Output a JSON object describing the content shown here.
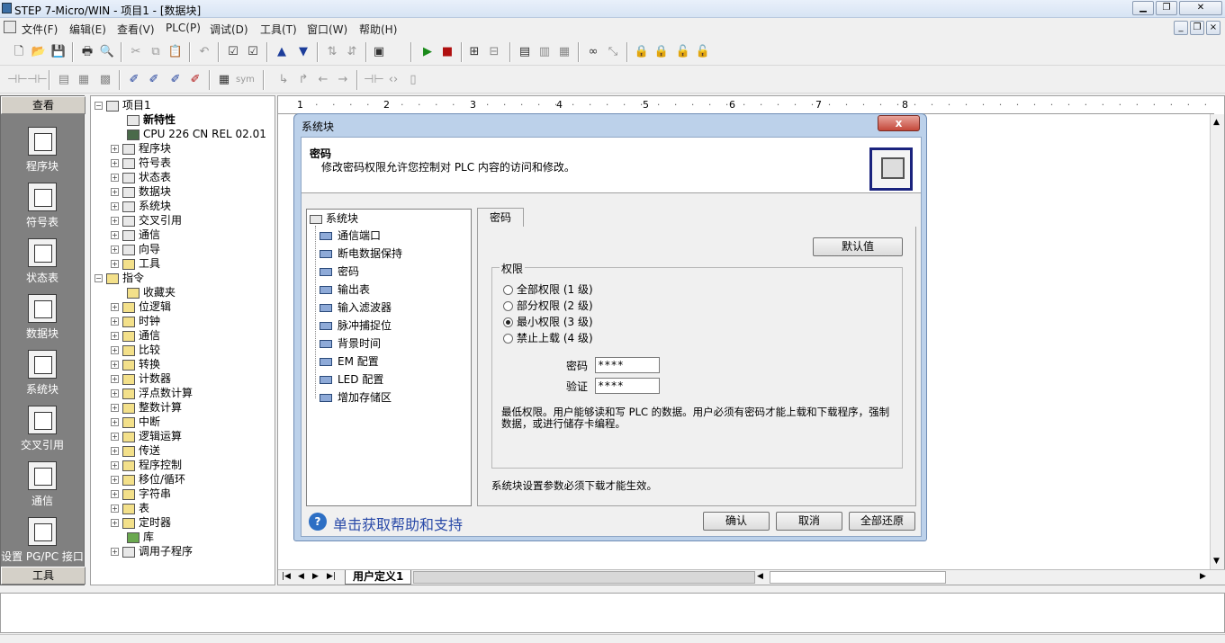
{
  "window": {
    "title": "STEP 7-Micro/WIN - 项目1 - [数据块]"
  },
  "menu": [
    "文件(F)",
    "编辑(E)",
    "查看(V)",
    "PLC(P)",
    "调试(D)",
    "工具(T)",
    "窗口(W)",
    "帮助(H)"
  ],
  "nav": {
    "header": "查看",
    "footer": "工具",
    "items": [
      "程序块",
      "符号表",
      "状态表",
      "数据块",
      "系统块",
      "交叉引用",
      "通信",
      "设置 PG/PC 接口"
    ]
  },
  "tree": {
    "root": "项目1",
    "items": [
      "新特性",
      "CPU 226 CN REL 02.01",
      "程序块",
      "符号表",
      "状态表",
      "数据块",
      "系统块",
      "交叉引用",
      "通信",
      "向导",
      "工具",
      "指令",
      "收藏夹",
      "位逻辑",
      "时钟",
      "通信",
      "比较",
      "转换",
      "计数器",
      "浮点数计算",
      "整数计算",
      "中断",
      "逻辑运算",
      "传送",
      "程序控制",
      "移位/循环",
      "字符串",
      "表",
      "定时器",
      "库",
      "调用子程序"
    ]
  },
  "ruler": [
    "1",
    "2",
    "3",
    "4",
    "5",
    "6",
    "7",
    "8"
  ],
  "editor": {
    "tab": "用户定义1"
  },
  "dialog": {
    "title": "系统块",
    "close": "x",
    "heading": "密码",
    "description": "修改密码权限允许您控制对 PLC 内容的访问和修改。",
    "tree_root": "系统块",
    "tree_items": [
      "通信端口",
      "断电数据保持",
      "密码",
      "输出表",
      "输入滤波器",
      "脉冲捕捉位",
      "背景时间",
      "EM 配置",
      "LED 配置",
      "增加存储区"
    ],
    "tab": "密码",
    "default_btn": "默认值",
    "group_label": "权限",
    "radios": [
      {
        "label": "全部权限  (1 级)",
        "checked": false
      },
      {
        "label": "部分权限  (2 级)",
        "checked": false
      },
      {
        "label": "最小权限  (3 级)",
        "checked": true
      },
      {
        "label": "禁止上载  (4 级)",
        "checked": false
      }
    ],
    "pwd_label": "密码",
    "pwd_value": "****",
    "verify_label": "验证",
    "verify_value": "****",
    "info": "最低权限。用户能够读和写 PLC 的数据。用户必须有密码才能上载和下载程序，强制数据，或进行储存卡编程。",
    "note": "系统块设置参数必须下载才能生效。",
    "help": "单击获取帮助和支持",
    "ok": "确认",
    "cancel": "取消",
    "restore": "全部还原"
  }
}
